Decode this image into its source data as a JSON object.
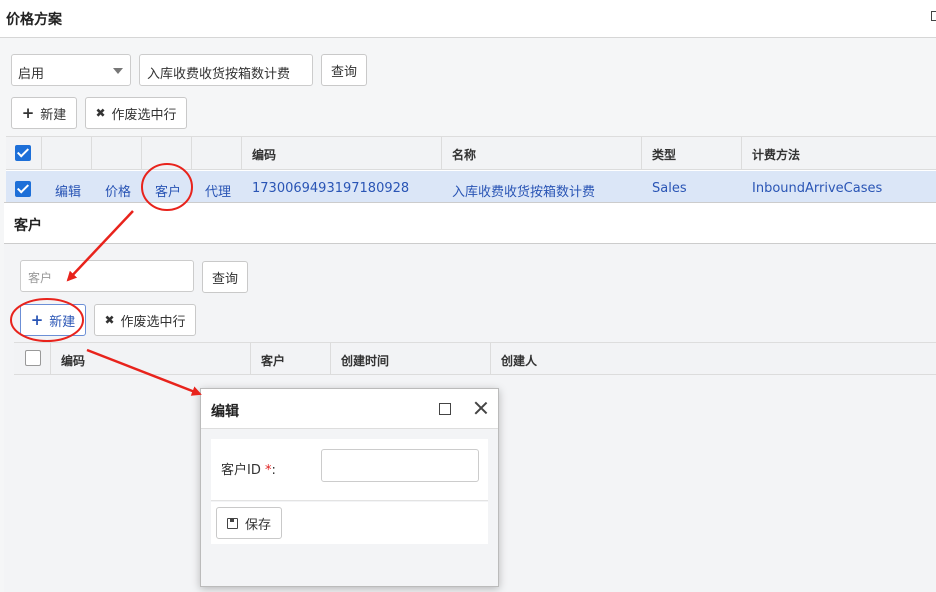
{
  "page": {
    "title": "价格方案"
  },
  "filters": {
    "status_value": "启用",
    "scheme_value": "入库收费收货按箱数计费",
    "query_label": "查询"
  },
  "toolbar": {
    "new_label": "新建",
    "void_label": "作废选中行"
  },
  "grid": {
    "headers": {
      "code": "编码",
      "name": "名称",
      "type": "类型",
      "method": "计费方法"
    },
    "row": {
      "edit": "编辑",
      "price": "价格",
      "customer": "客户",
      "agent": "代理",
      "code": "1730069493197180928",
      "name": "入库收费收货按箱数计费",
      "type": "Sales",
      "method": "InboundArriveCases"
    }
  },
  "customer_dialog": {
    "title": "客户",
    "search_placeholder": "客户",
    "query_label": "查询",
    "new_label": "新建",
    "void_label": "作废选中行",
    "headers": {
      "code": "编码",
      "customer": "客户",
      "created_time": "创建时间",
      "creator": "创建人"
    }
  },
  "edit_dialog": {
    "title": "编辑",
    "field_label": "客户ID",
    "required_mark": "*",
    "colon": ":",
    "save_label": "保存"
  },
  "colors": {
    "accent": "#1d6fd8",
    "link": "#2a55b5",
    "selected_row": "#dbe6f7",
    "annotation": "#e8231c"
  },
  "icons": [
    "plus-icon",
    "close-x-icon",
    "checkbox-checked-icon",
    "checkbox-empty-icon",
    "maximize-icon",
    "close-icon",
    "save-floppy-icon",
    "dropdown-caret-icon"
  ]
}
